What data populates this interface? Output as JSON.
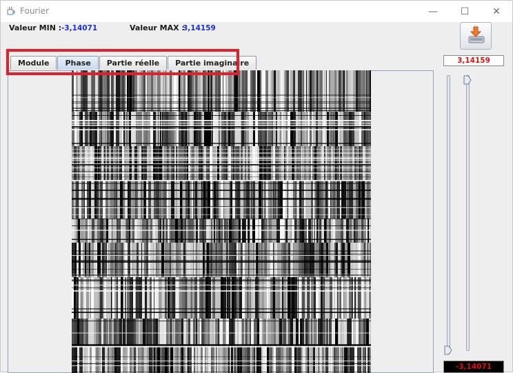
{
  "window": {
    "title": "Fourier",
    "min_label": "—",
    "max_label": "☐",
    "close_label": "✕"
  },
  "info": {
    "min_label": "Valeur MIN :",
    "min_value": "-3,14071",
    "max_label": "Valeur MAX :",
    "max_value": "3,14159"
  },
  "tabs": [
    {
      "label": "Module",
      "active": false
    },
    {
      "label": "Phase",
      "active": true
    },
    {
      "label": "Partie réelle",
      "active": false
    },
    {
      "label": "Partie imaginaire",
      "active": false
    }
  ],
  "range": {
    "max_display": "3,14159",
    "min_display": "-3,14071",
    "upper_slider_level": 1.0,
    "lower_slider_level": 0.0
  },
  "icons": {
    "app": "java-cup-icon",
    "save": "save-to-disk-icon"
  },
  "colors": {
    "value_blue": "#1b2fd0",
    "display_red": "#e01010",
    "highlight_red": "#e3202a"
  }
}
